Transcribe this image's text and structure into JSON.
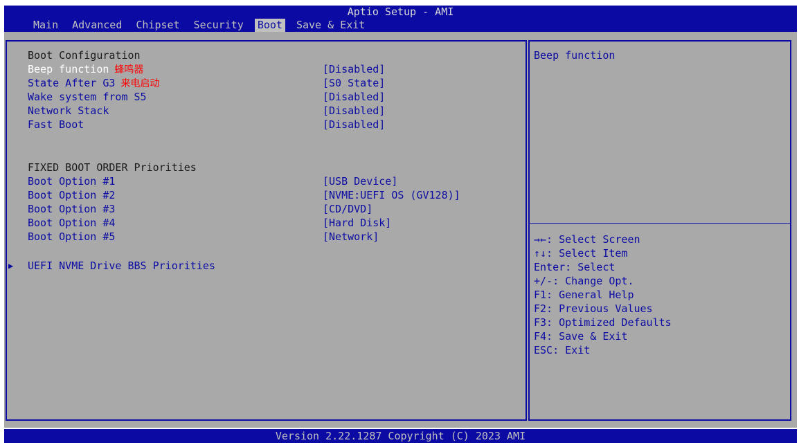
{
  "title": "Aptio Setup - AMI",
  "tabs": [
    "Main",
    "Advanced",
    "Chipset",
    "Security",
    "Boot",
    "Save & Exit"
  ],
  "active_tab": "Boot",
  "boot_config": {
    "header": "Boot Configuration",
    "items": [
      {
        "label": "Beep function",
        "note": "蜂鸣器",
        "value": "[Disabled]"
      },
      {
        "label": "State After G3",
        "note": "来电启动",
        "value": "[S0 State]"
      },
      {
        "label": "Wake system from S5",
        "value": "[Disabled]"
      },
      {
        "label": "Network Stack",
        "value": "[Disabled]"
      },
      {
        "label": "Fast Boot",
        "value": "[Disabled]"
      }
    ]
  },
  "boot_order": {
    "header": "FIXED BOOT ORDER Priorities",
    "items": [
      {
        "label": "Boot Option #1",
        "value": "[USB Device]"
      },
      {
        "label": "Boot Option #2",
        "value": "[NVME:UEFI OS (GV128)]"
      },
      {
        "label": "Boot Option #3",
        "value": "[CD/DVD]"
      },
      {
        "label": "Boot Option #4",
        "value": "[Hard Disk]"
      },
      {
        "label": "Boot Option #5",
        "value": "[Network]"
      }
    ]
  },
  "submenu": {
    "label": "UEFI NVME Drive BBS Priorities"
  },
  "help": {
    "text": "Beep function",
    "keys": [
      "→←: Select Screen",
      "↑↓: Select Item",
      "Enter: Select",
      "+/-: Change Opt.",
      "F1: General Help",
      "F2: Previous Values",
      "F3: Optimized Defaults",
      "F4: Save & Exit",
      "ESC: Exit"
    ]
  },
  "footer": "Version 2.22.1287 Copyright (C) 2023 AMI",
  "colors": {
    "bios_blue": "#0b0ba3",
    "panel_gray": "#a9a9a9",
    "tab_gray": "#c0c0c0",
    "note_red": "#ff0000",
    "selected_white": "#ffffff"
  }
}
